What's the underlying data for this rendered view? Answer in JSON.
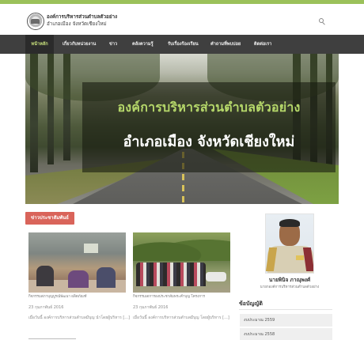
{
  "header": {
    "org_name": "องค์การบริหารส่วนตำบลตัวอย่าง",
    "org_sub": "อำเภอเมือง จังหวัดเชียงใหม่"
  },
  "nav": {
    "items": [
      {
        "label": "หน้าหลัก",
        "active": true
      },
      {
        "label": "เกี่ยวกับหน่วยงาน",
        "active": false
      },
      {
        "label": "ข่าว",
        "active": false
      },
      {
        "label": "คลังความรู้",
        "active": false
      },
      {
        "label": "รับเรื่องร้องเรียน",
        "active": false
      },
      {
        "label": "คำถามที่พบบ่อย",
        "active": false
      },
      {
        "label": "ติดต่อเรา",
        "active": false
      }
    ]
  },
  "hero": {
    "title": "องค์การบริหารส่วนตำบลตัวอย่าง",
    "subtitle": "อำเภอเมือง จังหวัดเชียงใหม่"
  },
  "news": {
    "section_label": "ข่าวประชาสัมพันธ์",
    "items": [
      {
        "caption": "กิจกรรมสภาบุญบูรณ์พัฒนา ผลิตภัณฑ์",
        "date": "23 กุมภาพันธ์ 2016",
        "excerpt": "เมื่อวันนี้ องค์การบริหารส่วนตำบลมีบุญ นำโดยผู้บริหาร [...]"
      },
      {
        "caption": "กิจกรรมเดการองประชาสัมพระคำบุญ โครงการ",
        "date": "23 กุมภาพันธ์ 2016",
        "excerpt": "เมื่อวันนี้ องค์การบริหารส่วนตำบลมีบุญ โดยผู้บริหาร [...]"
      }
    ]
  },
  "sidebar": {
    "person_name": "นายพินิจ ภาณุพงศ์",
    "person_title": "นายกองค์การบริหารส่วนตำบลตัวอย่าง",
    "accounts_title": "ข้อบัญญัติ",
    "accounts": [
      "งบประมาณ 2559",
      "งบประมาณ 2558"
    ]
  },
  "colors": {
    "accent_green": "#9bc15a",
    "nav_bg": "#3f3f3f",
    "section_tag": "#d9645a",
    "hero_title": "#b6d86a"
  },
  "icons": {
    "search": "search-icon",
    "logo": "org-seal-logo"
  }
}
